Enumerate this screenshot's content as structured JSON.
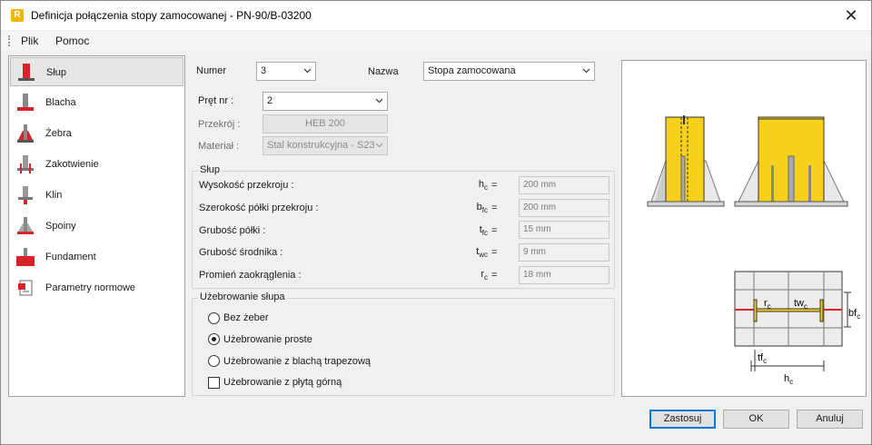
{
  "window": {
    "title": "Definicja połączenia stopy zamocowanej - PN-90/B-03200",
    "close_glyph": "✕",
    "app_icon_letter": "R"
  },
  "menu": {
    "items": [
      "Plik",
      "Pomoc"
    ]
  },
  "sidebar": {
    "items": [
      {
        "label": "Słup",
        "icon": "column-icon",
        "active": true
      },
      {
        "label": "Blacha",
        "icon": "plate-icon",
        "active": false
      },
      {
        "label": "Żebra",
        "icon": "ribs-icon",
        "active": false
      },
      {
        "label": "Zakotwienie",
        "icon": "anchor-icon",
        "active": false
      },
      {
        "label": "Klin",
        "icon": "wedge-icon",
        "active": false
      },
      {
        "label": "Spoiny",
        "icon": "welds-icon",
        "active": false
      },
      {
        "label": "Fundament",
        "icon": "foundation-icon",
        "active": false
      },
      {
        "label": "Parametry normowe",
        "icon": "code-params-icon",
        "active": false
      }
    ]
  },
  "form": {
    "number_label": "Numer",
    "number_value": "3",
    "name_label": "Nazwa",
    "name_value": "Stopa zamocowana",
    "bar_label": "Pręt nr :",
    "bar_value": "2",
    "section_label": "Przekrój :",
    "section_value": "HEB 200",
    "material_label": "Materiał :",
    "material_value": "Stal konstrukcyjna - S23"
  },
  "column_group": {
    "title": "Słup",
    "rows": [
      {
        "label": "Wysokość przekroju :",
        "sym": "h",
        "sub": "c",
        "value": "200 mm"
      },
      {
        "label": "Szerokość półki przekroju :",
        "sym": "b",
        "sub": "fc",
        "value": "200 mm"
      },
      {
        "label": "Grubość półki :",
        "sym": "t",
        "sub": "fc",
        "value": "15 mm"
      },
      {
        "label": "Grubość środnika :",
        "sym": "t",
        "sub": "wc",
        "value": "9 mm"
      },
      {
        "label": "Promień zaokrąglenia :",
        "sym": "r",
        "sub": "c",
        "value": "18 mm"
      }
    ],
    "eq": "="
  },
  "stiffening_group": {
    "title": "Użebrowanie słupa",
    "options": [
      {
        "label": "Bez żeber",
        "type": "radio",
        "checked": false
      },
      {
        "label": "Użebrowanie proste",
        "type": "radio",
        "checked": true
      },
      {
        "label": "Użebrowanie z blachą trapezową",
        "type": "radio",
        "checked": false
      },
      {
        "label": "Użebrowanie z płytą górną",
        "type": "checkbox",
        "checked": false
      }
    ]
  },
  "preview": {
    "labels": {
      "rc": "r",
      "rc_sub": "c",
      "twc": "tw",
      "twc_sub": "c",
      "bfc": "bf",
      "bfc_sub": "c",
      "tfc": "tf",
      "tfc_sub": "c",
      "hc": "h",
      "hc_sub": "c"
    }
  },
  "buttons": {
    "apply": "Zastosuj",
    "ok": "OK",
    "cancel": "Anuluj"
  },
  "colors": {
    "accent": "#0078d7",
    "steel_yellow": "#f5d11e",
    "steel_red": "#d9222a"
  }
}
